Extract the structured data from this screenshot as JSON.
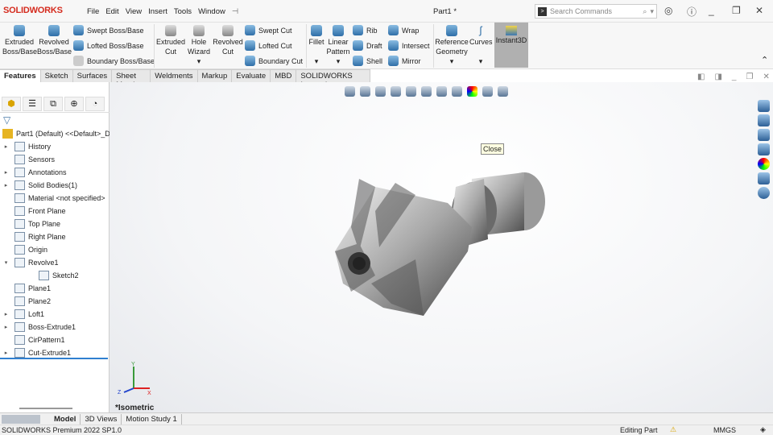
{
  "app": {
    "logo": "SOLIDWORKS",
    "title": "Part1 *",
    "search_placeholder": "Search Commands"
  },
  "menu": [
    "File",
    "Edit",
    "View",
    "Insert",
    "Tools",
    "Window"
  ],
  "ribbon": {
    "extruded_boss": "Extruded Boss/Base",
    "revolved_boss": "Revolved Boss/Base",
    "swept_boss": "Swept Boss/Base",
    "lofted_boss": "Lofted Boss/Base",
    "boundary_boss": "Boundary Boss/Base",
    "extruded_cut": "Extruded Cut",
    "hole_wizard": "Hole Wizard",
    "revolved_cut": "Revolved Cut",
    "swept_cut": "Swept Cut",
    "lofted_cut": "Lofted Cut",
    "boundary_cut": "Boundary Cut",
    "fillet": "Fillet",
    "linear_pattern": "Linear Pattern",
    "rib": "Rib",
    "draft": "Draft",
    "shell": "Shell",
    "wrap": "Wrap",
    "intersect": "Intersect",
    "mirror": "Mirror",
    "reference_geometry": "Reference Geometry",
    "curves": "Curves",
    "instant3d": "Instant3D"
  },
  "tabs": [
    "Features",
    "Sketch",
    "Surfaces",
    "Sheet Metal",
    "Weldments",
    "Markup",
    "Evaluate",
    "MBD",
    "SOLIDWORKS Inspection"
  ],
  "tree": {
    "root": "Part1 (Default) <<Default>_D",
    "items": [
      {
        "label": "History",
        "expand": true
      },
      {
        "label": "Sensors",
        "expand": false
      },
      {
        "label": "Annotations",
        "expand": true
      },
      {
        "label": "Solid Bodies(1)",
        "expand": true
      },
      {
        "label": "Material <not specified>",
        "expand": false
      },
      {
        "label": "Front Plane",
        "expand": false
      },
      {
        "label": "Top Plane",
        "expand": false
      },
      {
        "label": "Right Plane",
        "expand": false
      },
      {
        "label": "Origin",
        "expand": false
      },
      {
        "label": "Revolve1",
        "expand": "open"
      },
      {
        "label": "Sketch2",
        "expand": false,
        "indent": 1
      },
      {
        "label": "Plane1",
        "expand": false
      },
      {
        "label": "Plane2",
        "expand": false
      },
      {
        "label": "Loft1",
        "expand": true
      },
      {
        "label": "Boss-Extrude1",
        "expand": true
      },
      {
        "label": "CirPattern1",
        "expand": false
      },
      {
        "label": "Cut-Extrude1",
        "expand": true
      }
    ]
  },
  "viewport": {
    "tooltip": "Close",
    "view_name": "*Isometric",
    "triad": {
      "x": "X",
      "y": "Y",
      "z": "Z"
    }
  },
  "bottom_tabs": [
    "Model",
    "3D Views",
    "Motion Study 1"
  ],
  "status": {
    "version": "SOLIDWORKS Premium 2022 SP1.0",
    "mode": "Editing Part",
    "units": "MMGS"
  }
}
